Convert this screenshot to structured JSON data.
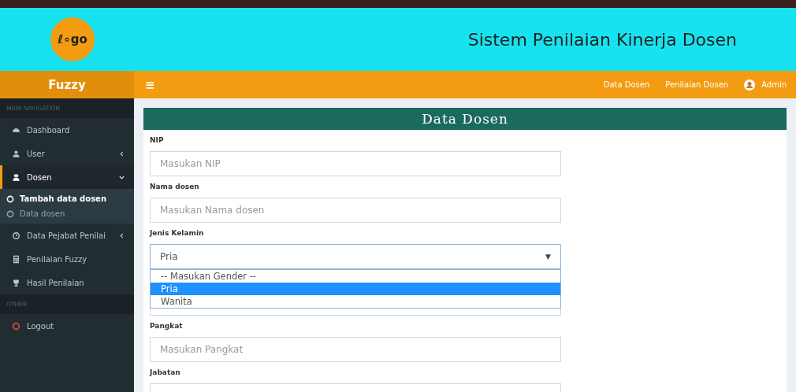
{
  "header": {
    "logo": "ℓ∘go",
    "title": "Sistem Penilaian Kinerja Dosen"
  },
  "navbar": {
    "brand": "Fuzzy",
    "menu_icon": "≡",
    "links": [
      "Data Dosen",
      "Penilaian Dosen"
    ],
    "user": "Admin"
  },
  "sidebar": {
    "sections": [
      {
        "header": "MAIN NAVIGATION",
        "items": [
          {
            "label": "Dashboard",
            "kind": "link",
            "selected": false
          },
          {
            "label": "User",
            "kind": "menu",
            "expanded": false,
            "selected": false
          },
          {
            "label": "Dosen",
            "kind": "menu",
            "expanded": true,
            "selected": true,
            "children": [
              {
                "label": "Tambah data dosen",
                "selected": true
              },
              {
                "label": "Data dosen",
                "selected": false
              }
            ]
          },
          {
            "label": "Data Pejabat Penilai",
            "kind": "menu",
            "expanded": false,
            "selected": false
          },
          {
            "label": "Penilaian Fuzzy",
            "kind": "link",
            "selected": false
          },
          {
            "label": "Hasil Penilaian",
            "kind": "link",
            "selected": false
          }
        ]
      },
      {
        "header": "OTHER",
        "items": [
          {
            "label": "Logout",
            "kind": "link",
            "selected": false
          }
        ]
      }
    ]
  },
  "card": {
    "title": "Data Dosen",
    "fields": [
      {
        "kind": "input",
        "label": "NIP",
        "placeholder": "Masukan NIP"
      },
      {
        "kind": "input",
        "label": "Nama dosen",
        "placeholder": "Masukan Nama dosen"
      },
      {
        "kind": "select",
        "label": "Jenis Kelamin",
        "value": "Pria",
        "caret": "▼",
        "open": true,
        "options": [
          {
            "label": "-- Masukan Gender --",
            "selected": false
          },
          {
            "label": "Pria",
            "selected": true
          },
          {
            "label": "Wanita",
            "selected": false
          }
        ]
      },
      {
        "kind": "input"
      },
      {
        "kind": "input",
        "label": "Pangkat",
        "placeholder": "Masukan Pangkat"
      },
      {
        "kind": "input",
        "label": "Jabatan"
      }
    ]
  }
}
